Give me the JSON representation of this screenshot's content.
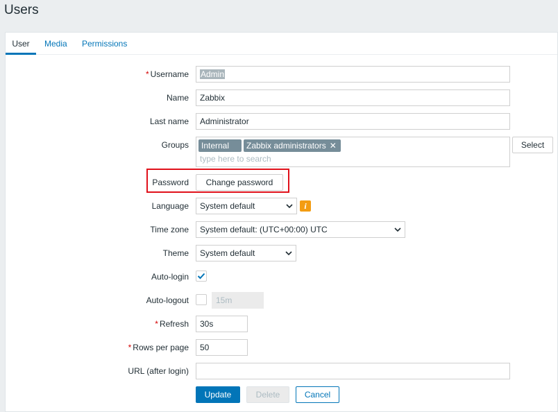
{
  "page": {
    "title": "Users"
  },
  "tabs": [
    {
      "label": "User",
      "active": true
    },
    {
      "label": "Media",
      "active": false
    },
    {
      "label": "Permissions",
      "active": false
    }
  ],
  "form": {
    "username": {
      "label": "Username",
      "required": "*",
      "value": "Admin"
    },
    "name": {
      "label": "Name",
      "value": "Zabbix"
    },
    "last_name": {
      "label": "Last name",
      "value": "Administrator"
    },
    "groups": {
      "label": "Groups",
      "chips": [
        "Internal",
        "Zabbix administrators"
      ],
      "placeholder": "type here to search",
      "select_label": "Select"
    },
    "password": {
      "label": "Password",
      "button": "Change password"
    },
    "language": {
      "label": "Language",
      "value": "System default",
      "info": "i"
    },
    "timezone": {
      "label": "Time zone",
      "value": "System default: (UTC+00:00) UTC"
    },
    "theme": {
      "label": "Theme",
      "value": "System default"
    },
    "autologin": {
      "label": "Auto-login",
      "checked": true
    },
    "autologout": {
      "label": "Auto-logout",
      "checked": false,
      "value": "15m"
    },
    "refresh": {
      "label": "Refresh",
      "required": "*",
      "value": "30s"
    },
    "rows_per_page": {
      "label": "Rows per page",
      "required": "*",
      "value": "50"
    },
    "url": {
      "label": "URL (after login)",
      "value": ""
    }
  },
  "actions": {
    "update": "Update",
    "delete": "Delete",
    "cancel": "Cancel"
  },
  "colors": {
    "accent": "#0275b8",
    "highlight": "#e0101a",
    "info": "#f39c12",
    "chip": "#768d99"
  }
}
